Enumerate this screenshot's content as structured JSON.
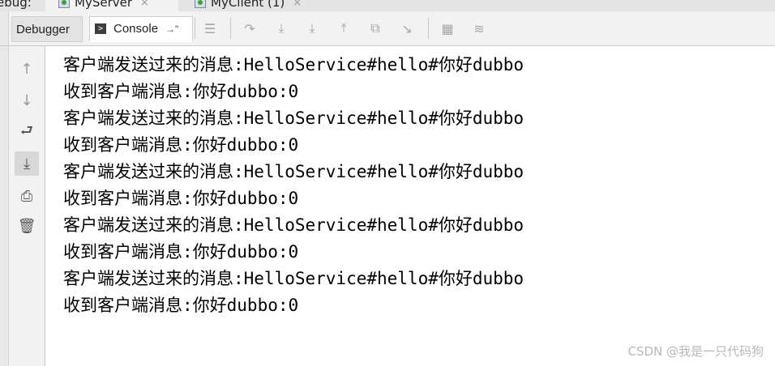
{
  "run_tabs": [
    {
      "label": "ebug:",
      "icon": null
    },
    {
      "label": "MyServer",
      "icon": "java-run-icon",
      "close": "×"
    },
    {
      "label": "MyClient (1)",
      "icon": "java-run-icon",
      "close": "×"
    }
  ],
  "toolbar": {
    "tabs": [
      {
        "label": "Debugger"
      },
      {
        "label": "Console",
        "icon": "console-icon",
        "pin": "→\""
      }
    ],
    "buttons": [
      {
        "name": "show-execution-point-icon",
        "glyph": "☰"
      },
      {
        "name": "step-over-icon",
        "glyph": "↷"
      },
      {
        "name": "step-into-icon",
        "glyph": "⤓"
      },
      {
        "name": "force-step-into-icon",
        "glyph": "⤓"
      },
      {
        "name": "step-out-icon",
        "glyph": "⤒"
      },
      {
        "name": "drop-frame-icon",
        "glyph": "⧉"
      },
      {
        "name": "run-to-cursor-icon",
        "glyph": "↘"
      },
      {
        "name": "evaluate-expression-icon",
        "glyph": "▦"
      },
      {
        "name": "trace-stream-icon",
        "glyph": "≋"
      }
    ]
  },
  "gutter": {
    "buttons": [
      {
        "name": "up-stack-frame-icon",
        "glyph": "↑"
      },
      {
        "name": "down-stack-frame-icon",
        "glyph": "↓"
      },
      {
        "name": "soft-wrap-icon",
        "glyph": "⮐"
      },
      {
        "name": "scroll-to-end-icon",
        "glyph": "⤓"
      },
      {
        "name": "print-icon",
        "glyph": "⎙"
      },
      {
        "name": "clear-all-icon",
        "glyph": "🗑"
      }
    ]
  },
  "console": {
    "lines": [
      "客户端发送过来的消息:HelloService#hello#你好dubbo",
      "收到客户端消息:你好dubbo:0",
      "客户端发送过来的消息:HelloService#hello#你好dubbo",
      "收到客户端消息:你好dubbo:0",
      "客户端发送过来的消息:HelloService#hello#你好dubbo",
      "收到客户端消息:你好dubbo:0",
      "客户端发送过来的消息:HelloService#hello#你好dubbo",
      "收到客户端消息:你好dubbo:0",
      "客户端发送过来的消息:HelloService#hello#你好dubbo",
      "收到客户端消息:你好dubbo:0"
    ]
  },
  "watermark": "CSDN @我是一只代码狗"
}
